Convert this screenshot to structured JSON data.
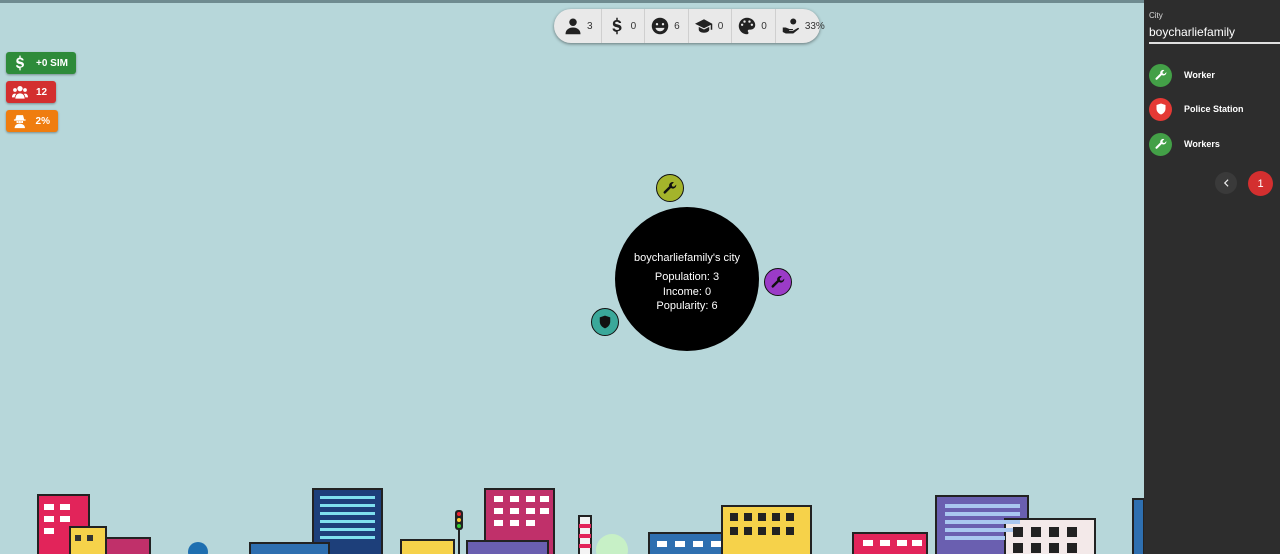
{
  "stats": [
    {
      "icon": "person-icon",
      "value": "3"
    },
    {
      "icon": "dollar-icon",
      "value": "0"
    },
    {
      "icon": "smile-icon",
      "value": "6"
    },
    {
      "icon": "graduation-cap-icon",
      "value": "0"
    },
    {
      "icon": "palette-icon",
      "value": "0"
    },
    {
      "icon": "hand-coin-icon",
      "value": "33%"
    }
  ],
  "badges": {
    "money": {
      "icon": "dollar-icon",
      "label": "+0 SIM",
      "color": "#2e8b3a"
    },
    "people": {
      "icon": "users-icon",
      "label": "12",
      "color": "#d32f2f"
    },
    "crime": {
      "icon": "thief-icon",
      "label": "2%",
      "color": "#ef7d0f"
    }
  },
  "city": {
    "title": "boycharliefamily's city",
    "population": "Population: 3",
    "income": "Income: 0",
    "popularity": "Popularity: 6",
    "orbit_colors": [
      "#a4b42b",
      "#9b3bc7",
      "#3aa89a"
    ]
  },
  "sidebar": {
    "label": "City",
    "value": "boycharliefamily",
    "items": [
      {
        "label": "Worker",
        "icon": "wrench-icon",
        "color": "#43a047"
      },
      {
        "label": "Police Station",
        "icon": "police-icon",
        "color": "#e53935"
      },
      {
        "label": "Workers",
        "icon": "wrench-icon",
        "color": "#43a047"
      }
    ],
    "page": "1"
  }
}
